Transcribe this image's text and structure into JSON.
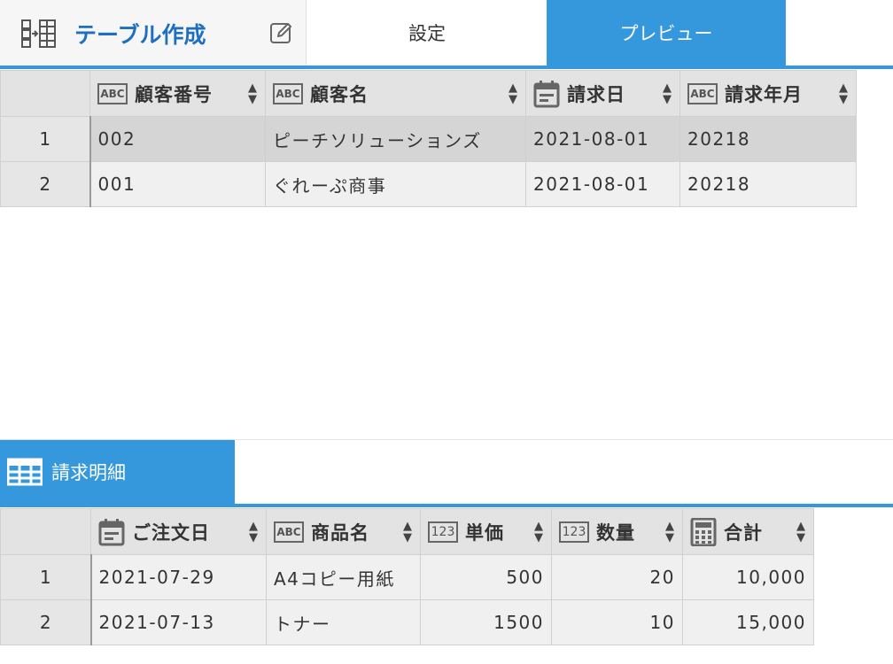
{
  "header": {
    "title": "テーブル作成",
    "tabs": [
      {
        "label": "設定",
        "active": false
      },
      {
        "label": "プレビュー",
        "active": true
      }
    ]
  },
  "colors": {
    "accent": "#3598dc",
    "title": "#1e6fbf"
  },
  "table1": {
    "columns": [
      {
        "label": "顧客番号",
        "type": "ABC"
      },
      {
        "label": "顧客名",
        "type": "ABC"
      },
      {
        "label": "請求日",
        "type": "calendar-icon"
      },
      {
        "label": "請求年月",
        "type": "ABC"
      }
    ],
    "rows": [
      {
        "num": "1",
        "cells": [
          "002",
          "ピーチソリューションズ",
          "2021-08-01",
          "20218"
        ]
      },
      {
        "num": "2",
        "cells": [
          "001",
          "ぐれーぷ商事",
          "2021-08-01",
          "20218"
        ]
      }
    ]
  },
  "section2": {
    "title": "請求明細",
    "columns": [
      {
        "label": "ご注文日",
        "type": "calendar-icon"
      },
      {
        "label": "商品名",
        "type": "ABC"
      },
      {
        "label": "単価",
        "type": "123"
      },
      {
        "label": "数量",
        "type": "123"
      },
      {
        "label": "合計",
        "type": "calculator-icon"
      }
    ],
    "rows": [
      {
        "num": "1",
        "cells": [
          "2021-07-29",
          "A4コピー用紙",
          "500",
          "20",
          "10,000"
        ]
      },
      {
        "num": "2",
        "cells": [
          "2021-07-13",
          "トナー",
          "1500",
          "10",
          "15,000"
        ]
      }
    ]
  },
  "icon_labels": {
    "abc": "ABC",
    "num": "123",
    "sort": "▲▼"
  }
}
